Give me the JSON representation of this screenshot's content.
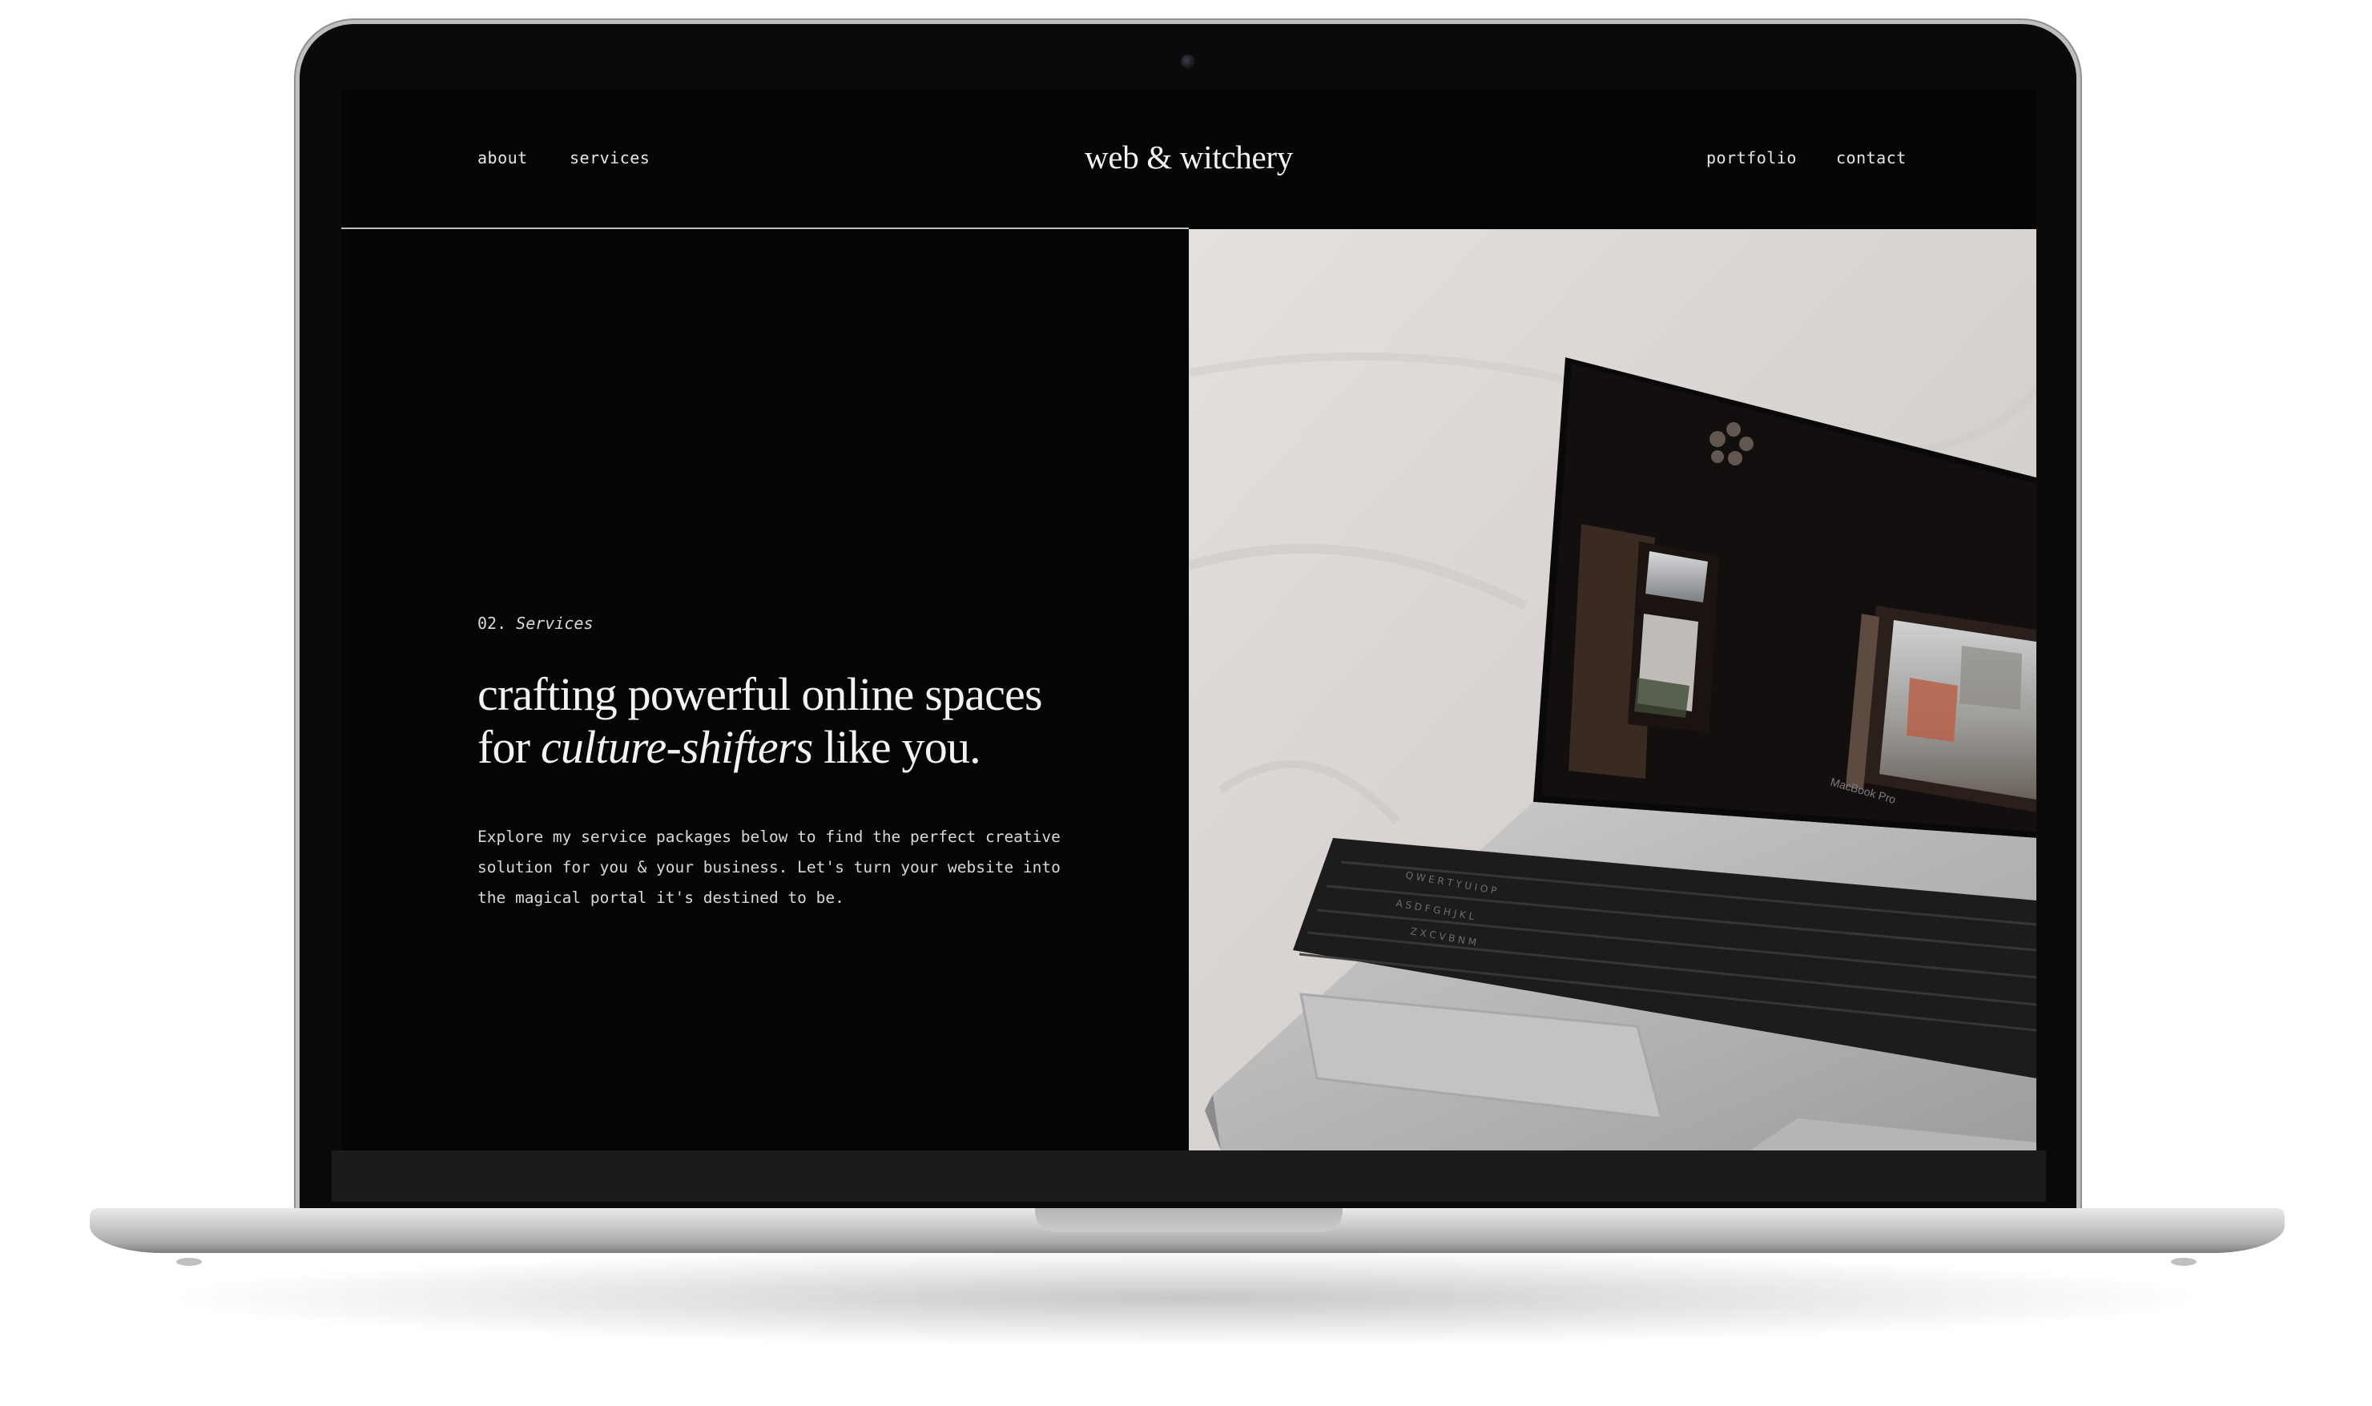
{
  "nav": {
    "left": [
      {
        "label": "about"
      },
      {
        "label": "services"
      }
    ],
    "brand": "web & witchery",
    "right": [
      {
        "label": "portfolio"
      },
      {
        "label": "contact"
      }
    ]
  },
  "hero": {
    "section_number": "02.",
    "section_label": "Services",
    "headline_line1": "crafting powerful online spaces",
    "headline_for": "for ",
    "headline_italic": "culture-shifters",
    "headline_end": " like you.",
    "body": "Explore my service packages below to find the perfect creative solution for you & your business. Let's turn your website into the magical portal it's destined to be."
  },
  "photo": {
    "laptop_label": "MacBook Pro",
    "subject": "open-laptop-photo"
  },
  "colors": {
    "background": "#050505",
    "text": "#f2f2f2",
    "divider": "#bdbdbd"
  }
}
